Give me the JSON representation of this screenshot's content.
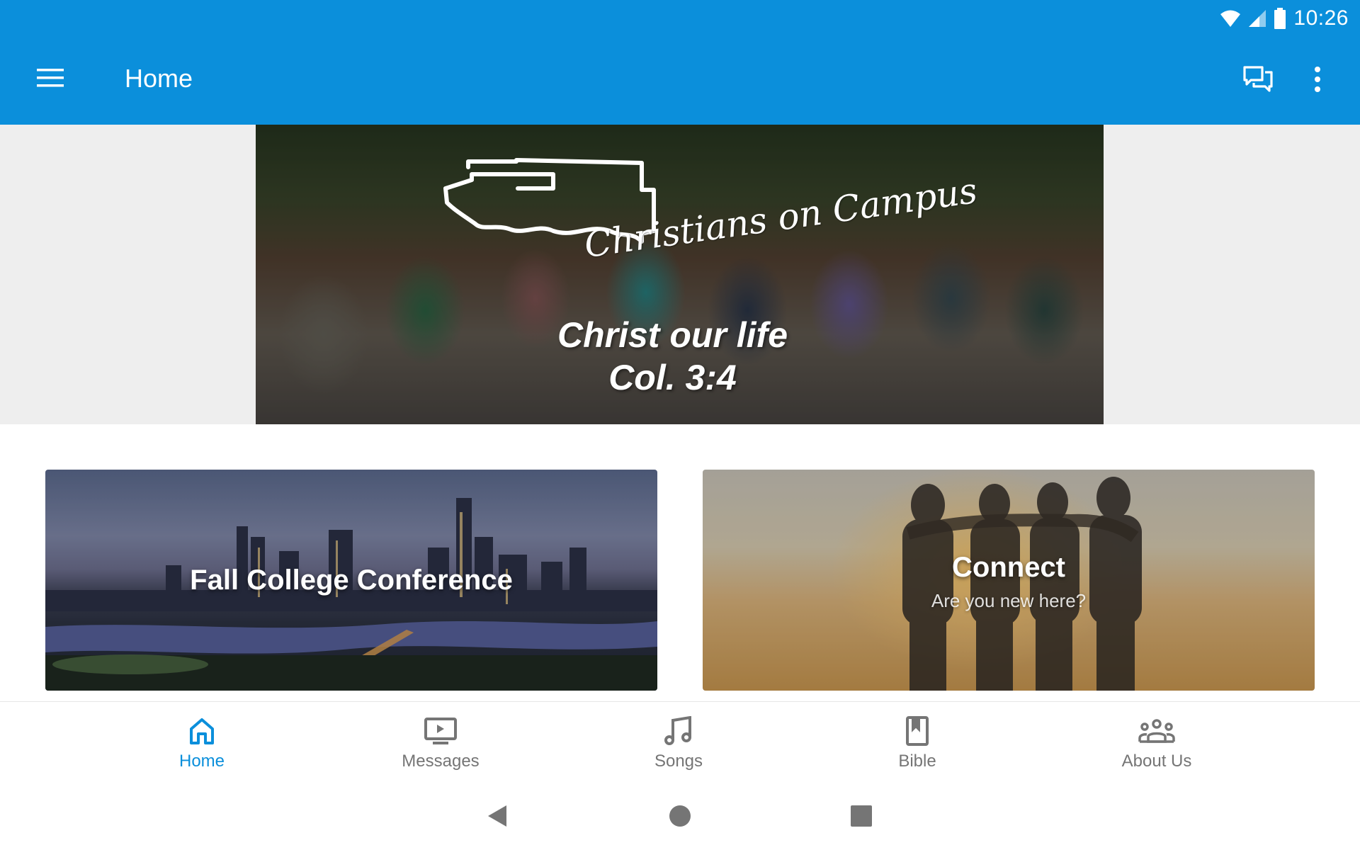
{
  "status_bar": {
    "time": "10:26",
    "icons": [
      "wifi-icon",
      "cell-signal-icon",
      "battery-icon"
    ]
  },
  "app_bar": {
    "title": "Home",
    "menu_icon": "hamburger-menu-icon",
    "actions": [
      "chat-icon",
      "more-vert-icon"
    ],
    "color": "#0B8FDB"
  },
  "hero": {
    "logo_script": "Christians on Campus",
    "tagline_line1": "Christ our life",
    "tagline_line2": "Col. 3:4"
  },
  "cards": {
    "fall": {
      "title": "Fall College Conference"
    },
    "connect": {
      "title": "Connect",
      "subtitle": "Are you new here?"
    }
  },
  "bottom_nav": {
    "active": "Home",
    "accent_color": "#0B8FDB",
    "items": [
      {
        "label": "Home",
        "icon": "home-icon"
      },
      {
        "label": "Messages",
        "icon": "video-icon"
      },
      {
        "label": "Songs",
        "icon": "music-note-icon"
      },
      {
        "label": "Bible",
        "icon": "book-icon"
      },
      {
        "label": "About Us",
        "icon": "group-icon"
      }
    ]
  },
  "system_nav": [
    "back-icon",
    "home-circle-icon",
    "recents-icon"
  ]
}
